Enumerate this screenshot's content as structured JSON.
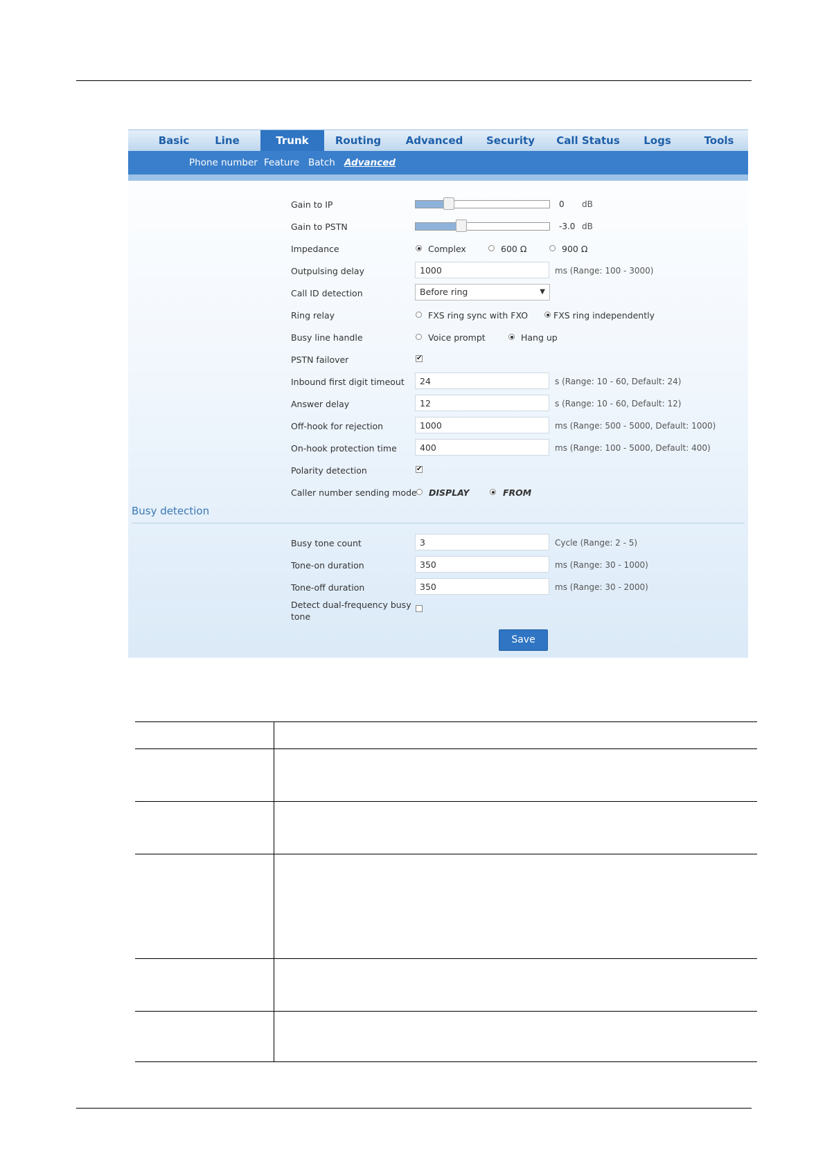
{
  "topnav": {
    "tabs": [
      "Basic",
      "Line",
      "Trunk",
      "Routing",
      "Advanced",
      "Security",
      "Call Status",
      "Logs",
      "Tools"
    ],
    "active": "Trunk"
  },
  "subnav": {
    "items": [
      "Phone number",
      "Feature",
      "Batch",
      "Advanced"
    ],
    "active": "Advanced"
  },
  "form": {
    "gain_to_ip": {
      "label": "Gain to IP",
      "value": "0",
      "unit": "dB"
    },
    "gain_to_pstn": {
      "label": "Gain to PSTN",
      "value": "-3.0",
      "unit": "dB"
    },
    "impedance": {
      "label": "Impedance",
      "options": [
        "Complex",
        "600 Ω",
        "900 Ω"
      ],
      "selected": "Complex"
    },
    "outpulsing_delay": {
      "label": "Outpulsing delay",
      "value": "1000",
      "hint": "ms (Range: 100 - 3000)"
    },
    "call_id_detection": {
      "label": "Call ID detection",
      "value": "Before ring"
    },
    "ring_relay": {
      "label": "Ring relay",
      "options": [
        "FXS ring sync with FXO",
        "FXS ring independently"
      ],
      "selected": "FXS ring independently"
    },
    "busy_line_handle": {
      "label": "Busy line handle",
      "options": [
        "Voice prompt",
        "Hang up"
      ],
      "selected": "Hang up"
    },
    "pstn_failover": {
      "label": "PSTN failover",
      "checked": true
    },
    "inbound_timeout": {
      "label": "Inbound first digit timeout",
      "value": "24",
      "hint": "s (Range: 10 - 60, Default: 24)"
    },
    "answer_delay": {
      "label": "Answer delay",
      "value": "12",
      "hint": "s (Range: 10 - 60, Default: 12)"
    },
    "offhook_rejection": {
      "label": "Off-hook for rejection",
      "value": "1000",
      "hint": "ms (Range: 500 - 5000, Default: 1000)"
    },
    "onhook_protection": {
      "label": "On-hook protection time",
      "value": "400",
      "hint": "ms (Range: 100 - 5000, Default: 400)"
    },
    "polarity_detection": {
      "label": "Polarity detection",
      "checked": true
    },
    "caller_sending_mode": {
      "label": "Caller number sending mode",
      "options": [
        "DISPLAY",
        "FROM"
      ],
      "selected": "FROM"
    }
  },
  "busy": {
    "title": "Busy detection",
    "tone_count": {
      "label": "Busy tone count",
      "value": "3",
      "hint": "Cycle (Range: 2 - 5)"
    },
    "tone_on": {
      "label": "Tone-on duration",
      "value": "350",
      "hint": "ms (Range: 30 - 1000)"
    },
    "tone_off": {
      "label": "Tone-off duration",
      "value": "350",
      "hint": "ms (Range: 30 - 2000)"
    },
    "dual_freq": {
      "label_line1": "Detect dual-frequency busy",
      "label_line2": "tone",
      "checked": false
    }
  },
  "save_label": "Save",
  "sliders": {
    "gain_to_ip_fraction": 0.25,
    "gain_to_pstn_fraction": 0.34
  }
}
